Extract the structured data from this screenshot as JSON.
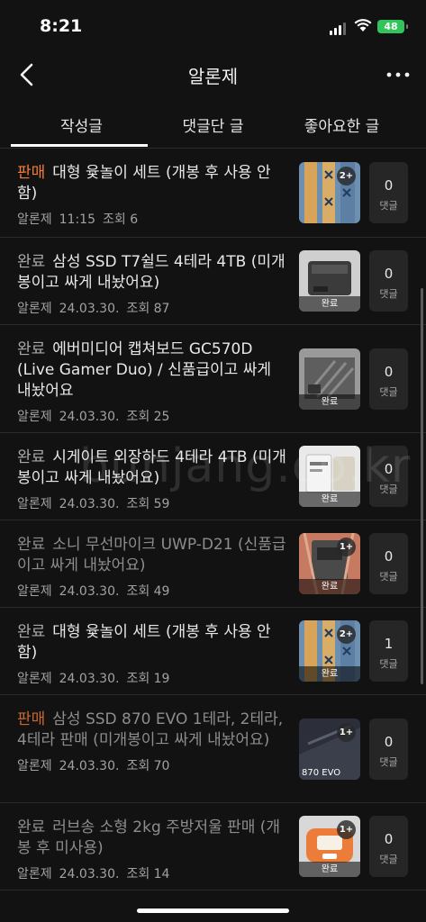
{
  "status_bar": {
    "time": "8:21",
    "battery": "48"
  },
  "header": {
    "title": "알론제"
  },
  "tabs": [
    {
      "label": "작성글",
      "active": true
    },
    {
      "label": "댓글단 글",
      "active": false
    },
    {
      "label": "좋아요한 글",
      "active": false
    }
  ],
  "watermark": "bunjang.co.kr",
  "comment_label": "댓글",
  "posts": [
    {
      "status": "판매",
      "title": "대형 윷놀이 세트 (개봉 후 사용 안함)",
      "author": "알론제",
      "date": "11:15",
      "views": "조회 6",
      "comments": "0",
      "photo_count": "2+",
      "thumb_done": "",
      "thumb_kind": "yut"
    },
    {
      "status": "완료",
      "title": "삼성 SSD T7쉴드 4테라 4TB (미개봉이고 싸게 내놨어요)",
      "author": "알론제",
      "date": "24.03.30.",
      "views": "조회 87",
      "comments": "0",
      "photo_count": "",
      "thumb_done": "완료",
      "thumb_kind": "ssd"
    },
    {
      "status": "완료",
      "title": "에버미디어 캡쳐보드 GC570D (Live Gamer Duo) / 신품급이고 싸게 내놨어요",
      "author": "알론제",
      "date": "24.03.30.",
      "views": "조회 25",
      "comments": "0",
      "photo_count": "",
      "thumb_done": "완료",
      "thumb_kind": "board"
    },
    {
      "status": "완료",
      "title": "시게이트 외장하드 4테라 4TB (미개봉이고 싸게 내놨어요)",
      "author": "알론제",
      "date": "24.03.30.",
      "views": "조회 59",
      "comments": "0",
      "photo_count": "",
      "thumb_done": "완료",
      "thumb_kind": "hdd"
    },
    {
      "status": "완료",
      "title": "소니 무선마이크 UWP-D21 (신품급이고 싸게 내놨어요)",
      "author": "알론제",
      "date": "24.03.30.",
      "views": "조회 49",
      "comments": "0",
      "photo_count": "1+",
      "thumb_done": "완료",
      "thumb_kind": "mic",
      "dim": true
    },
    {
      "status": "완료",
      "title": "대형 윷놀이 세트 (개봉 후 사용 안함)",
      "author": "알론제",
      "date": "24.03.30.",
      "views": "조회 19",
      "comments": "1",
      "photo_count": "2+",
      "thumb_done": "완료",
      "thumb_kind": "yut"
    },
    {
      "status": "판매",
      "title": "삼성 SSD 870 EVO 1테라, 2테라, 4테라 판매 (미개봉이고 싸게 내놨어요)",
      "author": "알론제",
      "date": "24.03.30.",
      "views": "조회 70",
      "comments": "0",
      "photo_count": "1+",
      "thumb_done": "",
      "thumb_label": "870 EVO",
      "thumb_kind": "evo",
      "dim": true
    },
    {
      "status": "완료",
      "title": "러브송 소형 2kg 주방저울 판매 (개봉 후 미사용)",
      "author": "알론제",
      "date": "24.03.30.",
      "views": "조회 14",
      "comments": "0",
      "photo_count": "1+",
      "thumb_done": "완료",
      "thumb_kind": "scale",
      "dim": true
    }
  ]
}
